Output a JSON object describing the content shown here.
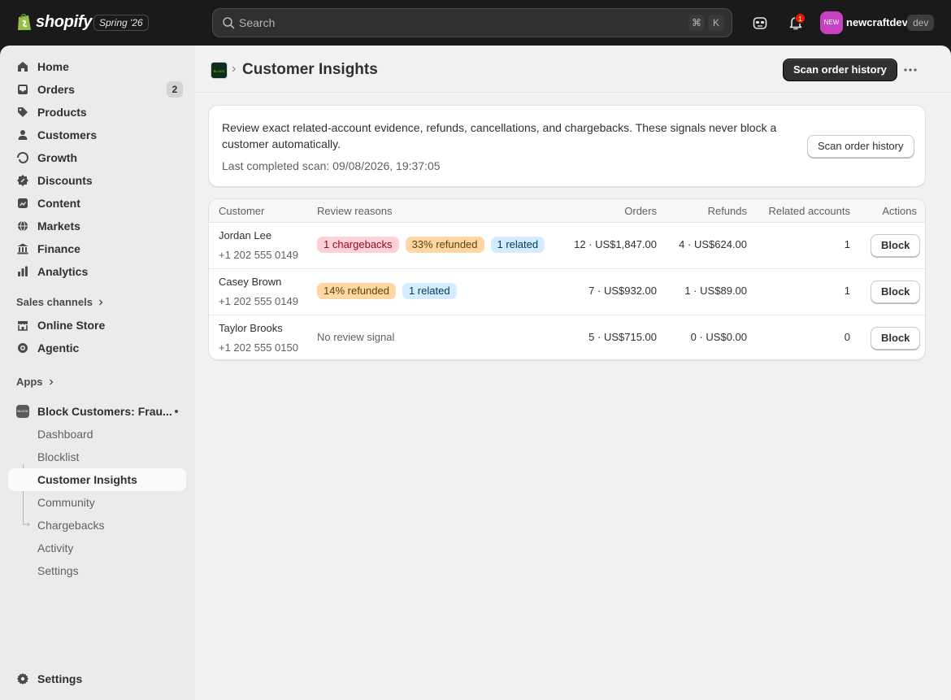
{
  "topbar": {
    "brand": "shopify",
    "edition": "Spring '26",
    "search_placeholder": "Search",
    "shortcut_cmd": "⌘",
    "shortcut_key": "K",
    "notification_count": "1",
    "avatar_text": "NEW",
    "store_name": "newcraftdev",
    "store_badge": "dev"
  },
  "sidebar": {
    "items": [
      {
        "label": "Home",
        "icon": "home-icon"
      },
      {
        "label": "Orders",
        "icon": "inbox-icon",
        "count": "2"
      },
      {
        "label": "Products",
        "icon": "tag-icon"
      },
      {
        "label": "Customers",
        "icon": "person-icon"
      },
      {
        "label": "Growth",
        "icon": "growth-icon"
      },
      {
        "label": "Discounts",
        "icon": "discount-icon"
      },
      {
        "label": "Content",
        "icon": "content-icon"
      },
      {
        "label": "Markets",
        "icon": "globe-icon"
      },
      {
        "label": "Finance",
        "icon": "bank-icon"
      },
      {
        "label": "Analytics",
        "icon": "chart-icon"
      }
    ],
    "sales_channels_label": "Sales channels",
    "channels": [
      {
        "label": "Online Store",
        "icon": "store-icon"
      },
      {
        "label": "Agentic",
        "icon": "agentic-icon"
      }
    ],
    "apps_label": "Apps",
    "app": {
      "name": "Block Customers: Frau...",
      "icon_text": "BLOCK",
      "subitems": [
        "Dashboard",
        "Blocklist",
        "Customer Insights",
        "Community",
        "Chargebacks",
        "Activity",
        "Settings"
      ],
      "active": "Customer Insights"
    },
    "settings_label": "Settings"
  },
  "page": {
    "title": "Customer Insights",
    "app_icon_text": "BLOCK",
    "primary_action": "Scan order history"
  },
  "info": {
    "text": "Review exact related-account evidence, refunds, cancellations, and chargebacks. These signals never block a customer automatically.",
    "last_scan": "Last completed scan: 09/08/2026, 19:37:05",
    "button": "Scan order history"
  },
  "table": {
    "headers": {
      "customer": "Customer",
      "reasons": "Review reasons",
      "orders": "Orders",
      "refunds": "Refunds",
      "related": "Related accounts",
      "actions": "Actions"
    },
    "rows": [
      {
        "name": "Jordan Lee",
        "phone": "+1 202 555 0149",
        "chip1": "1 chargebacks",
        "chip2": "33% refunded",
        "chip3": "1 related",
        "orders": "12 · US$1,847.00",
        "refunds": "4 · US$624.00",
        "related": "1",
        "action": "Block"
      },
      {
        "name": "Casey Brown",
        "phone": "+1 202 555 0149",
        "chip1": "14% refunded",
        "chip2": "1 related",
        "orders": "7 · US$932.00",
        "refunds": "1 · US$89.00",
        "related": "1",
        "action": "Block"
      },
      {
        "name": "Taylor Brooks",
        "phone": "+1 202 555 0150",
        "reason_text": "No review signal",
        "orders": "5 · US$715.00",
        "refunds": "0 · US$0.00",
        "related": "0",
        "action": "Block"
      }
    ]
  }
}
